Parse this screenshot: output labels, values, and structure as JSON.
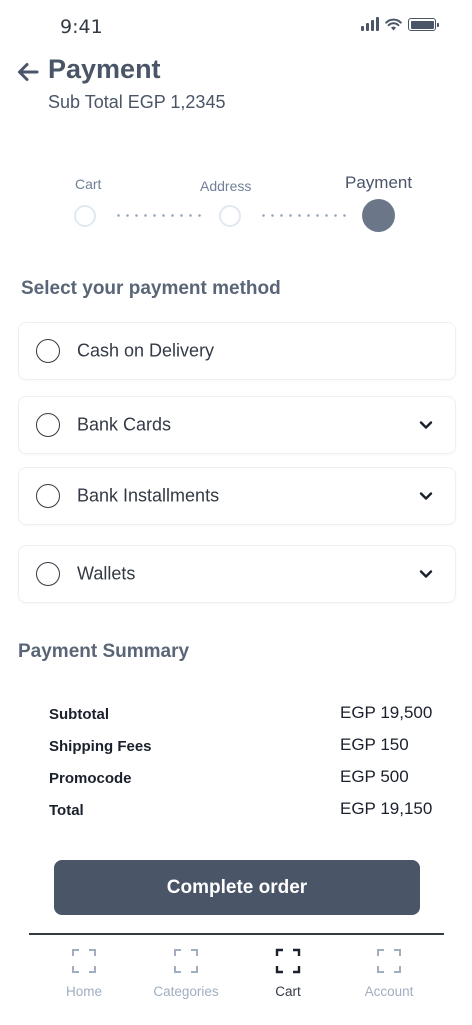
{
  "status_bar": {
    "time": "9:41"
  },
  "header": {
    "title": "Payment",
    "subtotal": "Sub Total EGP 1,2345"
  },
  "stepper": {
    "steps": [
      {
        "label": "Cart",
        "state": "pending"
      },
      {
        "label": "Address",
        "state": "pending"
      },
      {
        "label": "Payment",
        "state": "active"
      }
    ]
  },
  "payment_methods": {
    "title": "Select your payment method",
    "options": [
      {
        "label": "Cash on Delivery",
        "expandable": false,
        "selected": false
      },
      {
        "label": "Bank Cards",
        "expandable": true,
        "selected": false
      },
      {
        "label": "Bank Installments",
        "expandable": true,
        "selected": false
      },
      {
        "label": "Wallets",
        "expandable": true,
        "selected": false
      }
    ]
  },
  "summary": {
    "title": "Payment Summary",
    "rows": [
      {
        "label": "Subtotal",
        "value": "EGP 19,500"
      },
      {
        "label": "Shipping Fees",
        "value": "EGP 150"
      },
      {
        "label": "Promocode",
        "value": "EGP 500"
      },
      {
        "label": "Total",
        "value": "EGP 19,150"
      }
    ]
  },
  "complete_button": {
    "label": "Complete order"
  },
  "bottom_nav": {
    "items": [
      {
        "label": "Home",
        "icon": "home-icon",
        "active": false
      },
      {
        "label": "Categories",
        "icon": "categories-icon",
        "active": false
      },
      {
        "label": "Cart",
        "icon": "cart-icon",
        "active": true
      },
      {
        "label": "Account",
        "icon": "account-icon",
        "active": false
      }
    ]
  },
  "colors": {
    "primary": "#4a5568",
    "active_step": "#6b7789",
    "text_dark": "#1a202c",
    "muted": "#a0aec0"
  }
}
